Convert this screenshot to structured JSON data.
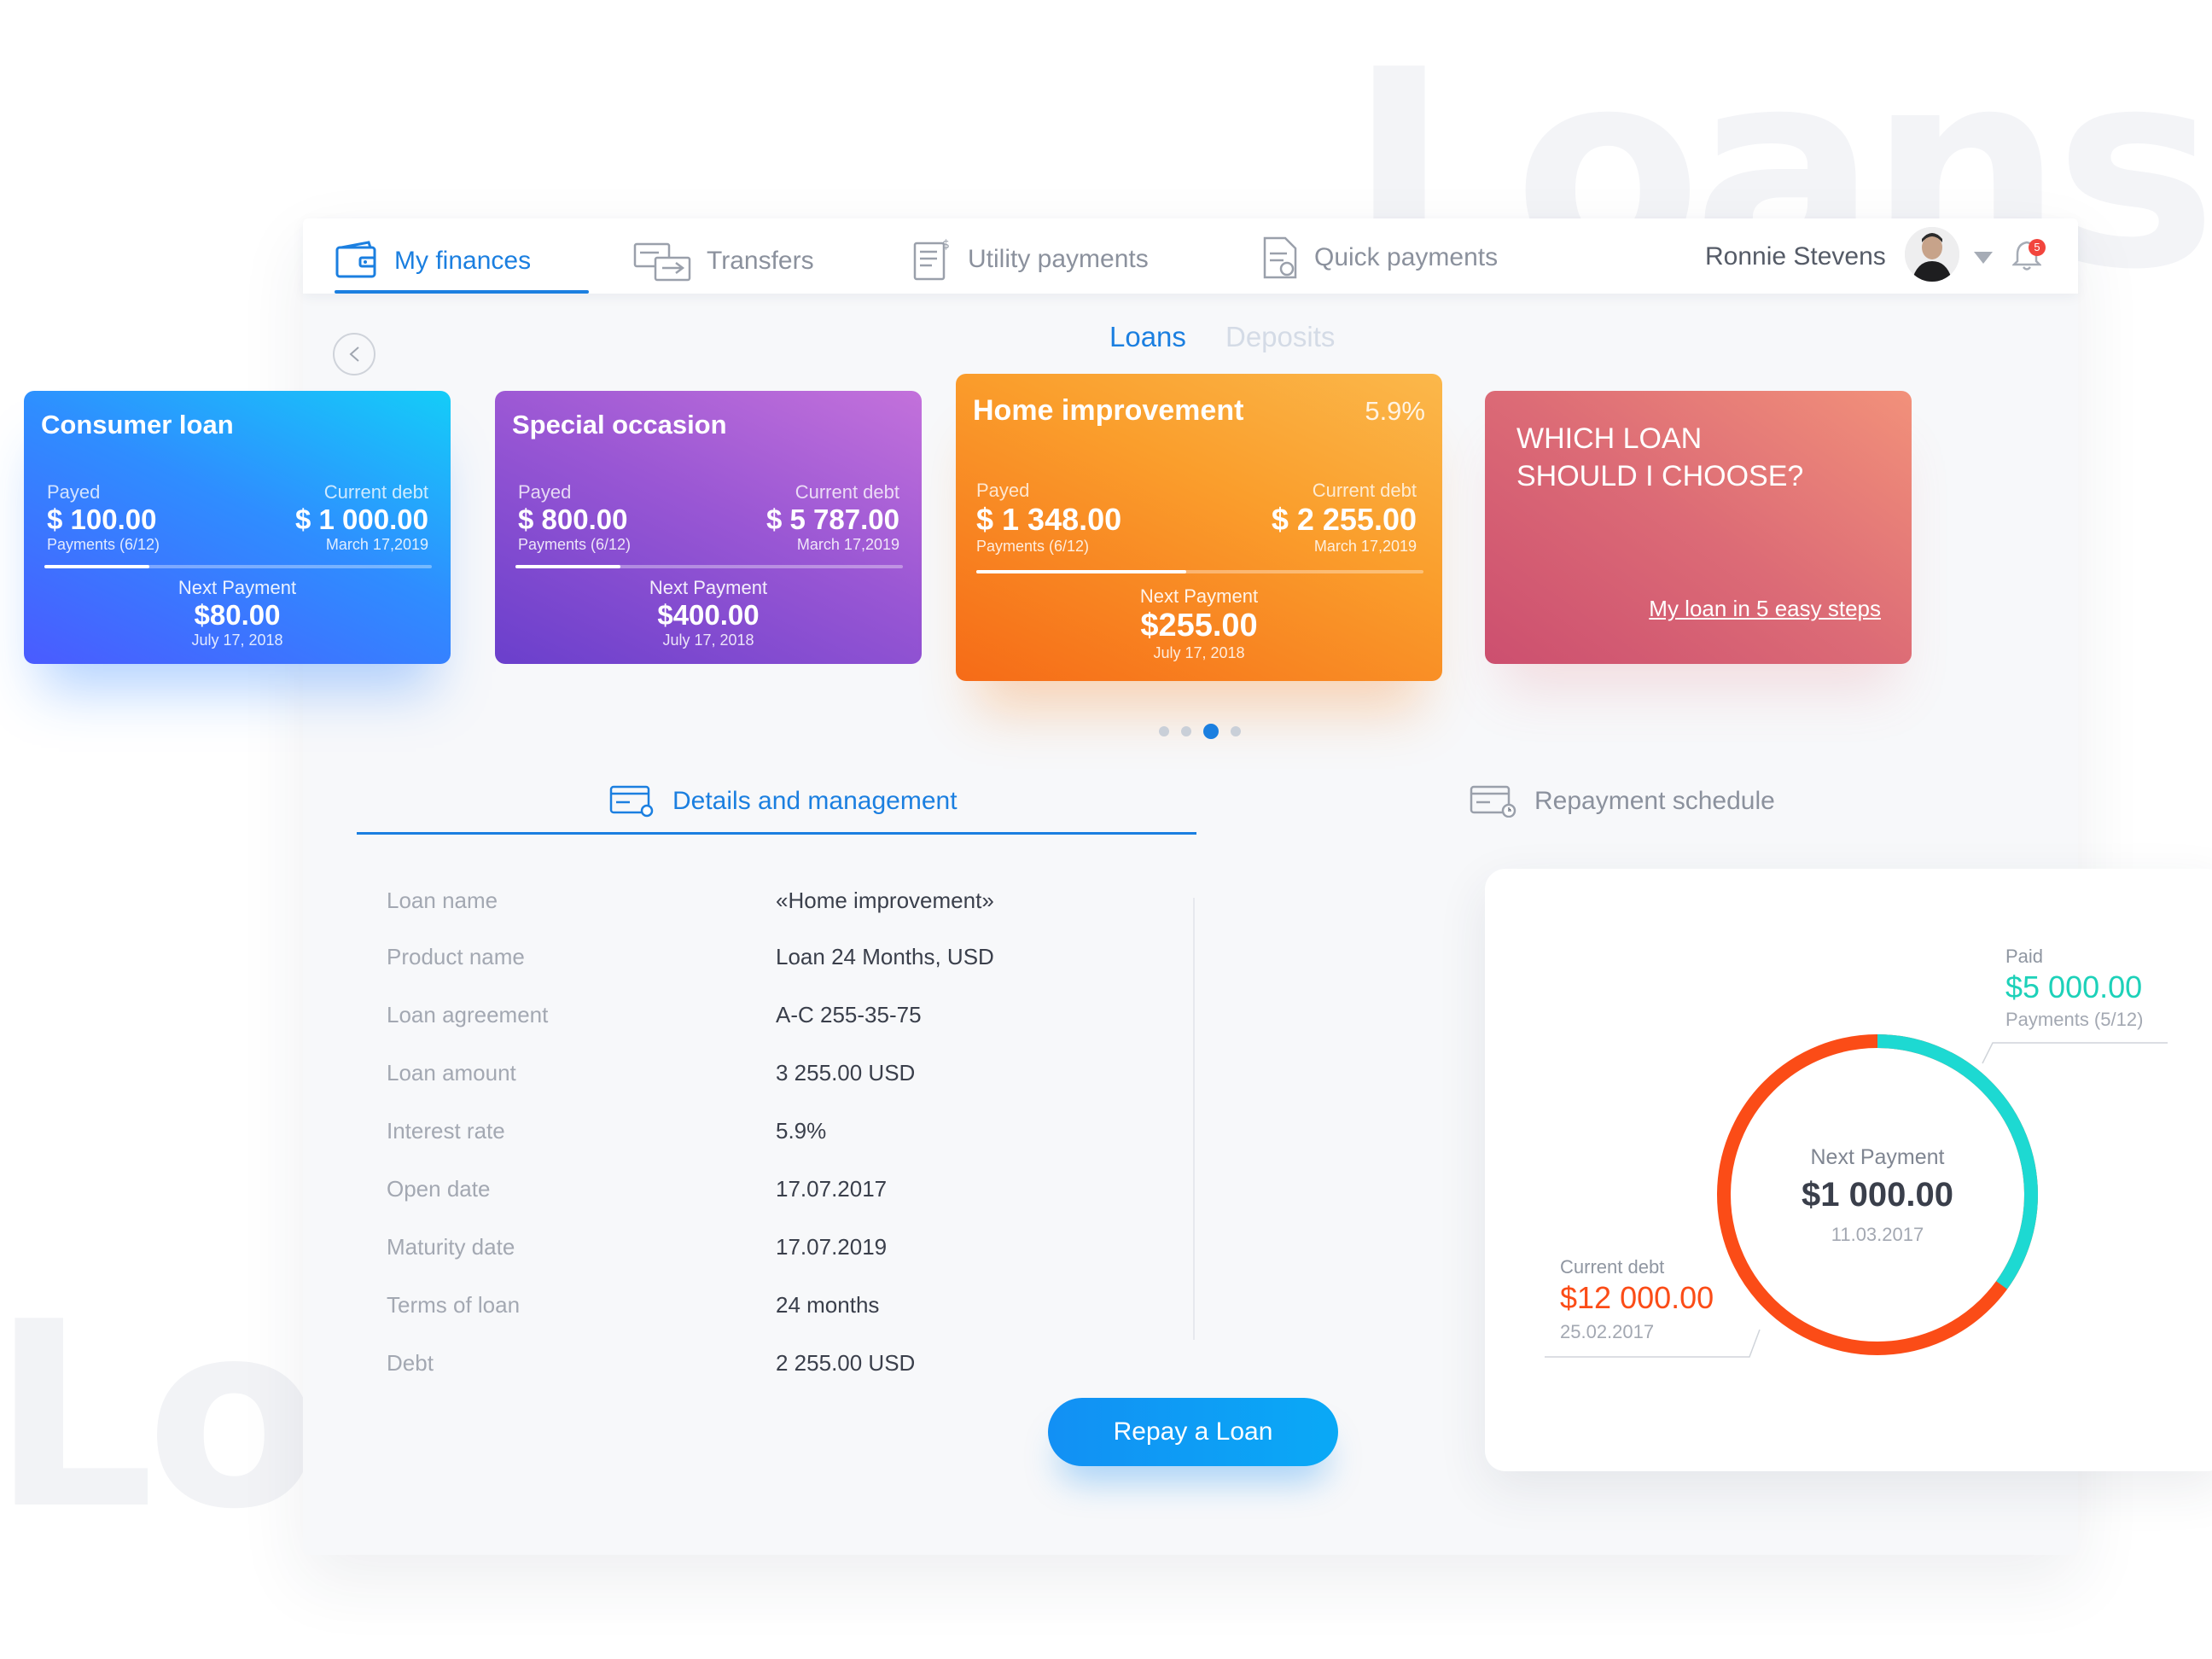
{
  "background_words": {
    "top": "Loans",
    "bottom": "Loans"
  },
  "nav": {
    "items": [
      {
        "label": "My finances",
        "icon": "wallet-icon",
        "active": true
      },
      {
        "label": "Transfers",
        "icon": "transfer-icon",
        "active": false
      },
      {
        "label": "Utility payments",
        "icon": "utility-icon",
        "active": false
      },
      {
        "label": "Quick payments",
        "icon": "document-icon",
        "active": false
      }
    ],
    "user_name": "Ronnie Stevens",
    "notification_count": "5"
  },
  "subtabs": {
    "active": "Loans",
    "inactive": "Deposits"
  },
  "cards": [
    {
      "title": "Consumer loan",
      "payed_label": "Payed",
      "payed": "$ 100.00",
      "payments": "Payments (6/12)",
      "debt_label": "Current debt",
      "debt": "$ 1 000.00",
      "debt_date": "March 17,2019",
      "next_label": "Next Payment",
      "next": "$80.00",
      "next_date": "July 17, 2018",
      "progress": 0.27
    },
    {
      "title": "Special occasion",
      "payed_label": "Payed",
      "payed": "$ 800.00",
      "payments": "Payments (6/12)",
      "debt_label": "Current debt",
      "debt": "$ 5 787.00",
      "debt_date": "March 17,2019",
      "next_label": "Next Payment",
      "next": "$400.00",
      "next_date": "July 17, 2018",
      "progress": 0.27
    },
    {
      "title": "Home improvement",
      "rate": "5.9%",
      "payed_label": "Payed",
      "payed": "$ 1 348.00",
      "payments": "Payments (6/12)",
      "debt_label": "Current debt",
      "debt": "$ 2 255.00",
      "debt_date": "March 17,2019",
      "next_label": "Next Payment",
      "next": "$255.00",
      "next_date": "July 17, 2018",
      "progress": 0.47
    }
  ],
  "promo": {
    "question_line1": "WHICH LOAN",
    "question_line2": "SHOULD I CHOOSE?",
    "link": "My loan in 5 easy steps"
  },
  "detail_tabs": {
    "active": "Details and management",
    "inactive": "Repayment schedule"
  },
  "details": [
    {
      "key": "Loan name",
      "value": "«Home improvement»"
    },
    {
      "key": "Product name",
      "value": "Loan 24 Months, USD"
    },
    {
      "key": "Loan  agreement",
      "value": "A-C 255-35-75"
    },
    {
      "key": " Loan amount",
      "value": "3 255.00 USD"
    },
    {
      "key": "Interest rate",
      "value": "5.9%"
    },
    {
      "key": "Open date",
      "value": "17.07.2017"
    },
    {
      "key": "Maturity  date",
      "value": "17.07.2019"
    },
    {
      "key": "Terms of loan",
      "value": "24 months"
    },
    {
      "key": "Debt",
      "value": "2 255.00 USD"
    }
  ],
  "repay_button": "Repay a Loan",
  "donut": {
    "paid_label": "Paid",
    "paid": "$5 000.00",
    "paid_payments": "Payments (5/12)",
    "debt_label": "Current debt",
    "debt": "$12 000.00",
    "debt_date": "25.02.2017",
    "center_label": "Next Payment",
    "center_amount": "$1 000.00",
    "center_date": "11.03.2017",
    "paid_color": "#1dd9d2",
    "debt_color": "#fb4c17",
    "paid_fraction": 0.35
  },
  "colors": {
    "accent": "#1b7fe0"
  }
}
